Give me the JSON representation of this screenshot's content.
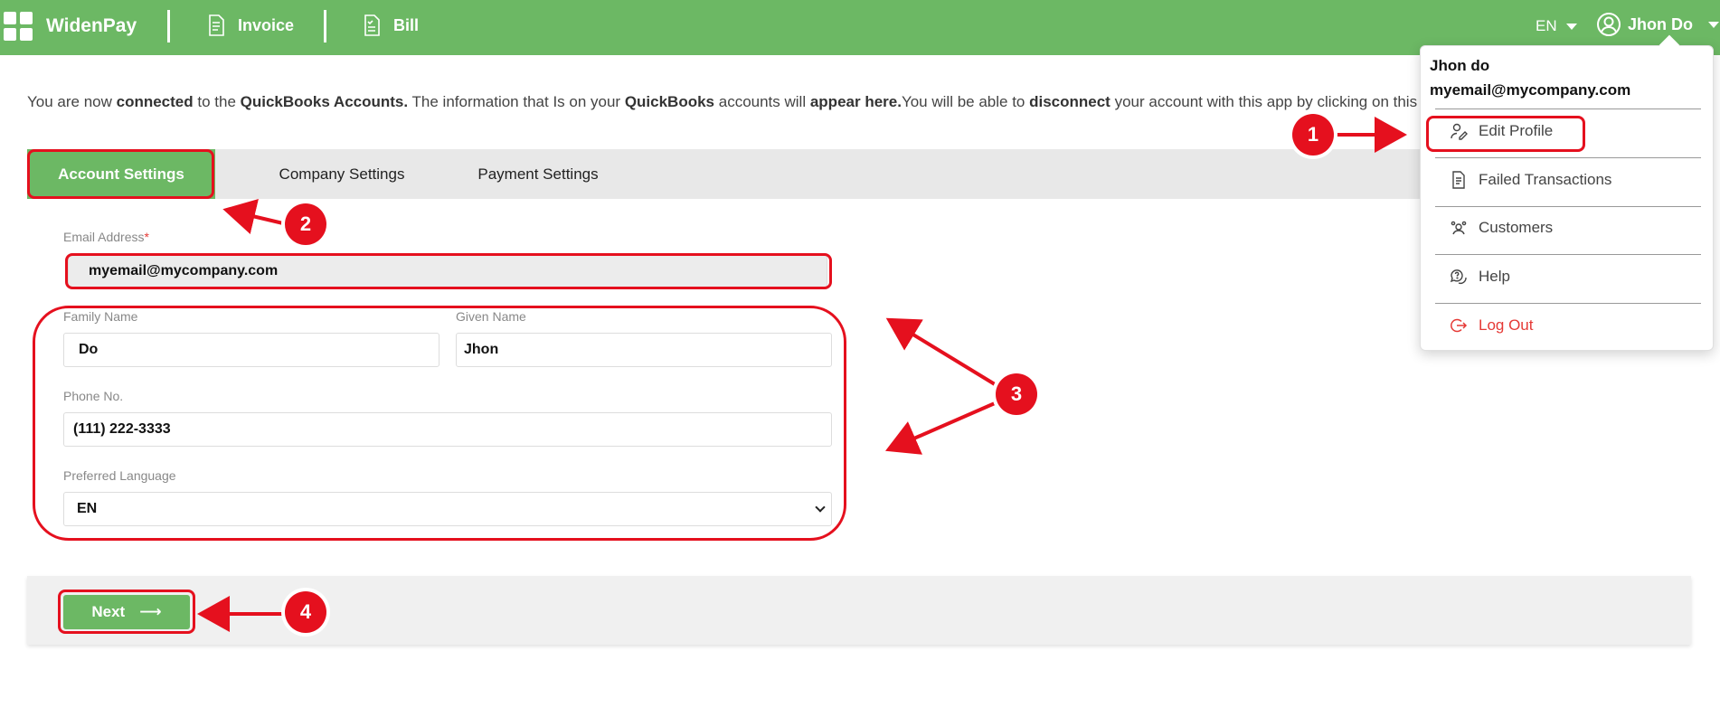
{
  "topbar": {
    "brand": "WidenPay",
    "nav": [
      {
        "label": "Invoice"
      },
      {
        "label": "Bill"
      }
    ],
    "language": "EN",
    "user": "Jhon Do"
  },
  "info": {
    "t1": "You are now ",
    "b1": "connected",
    "t2": " to the ",
    "b2": "QuickBooks Accounts.",
    "t3": " The information that Is on your ",
    "b3": "QuickBooks",
    "t4": " accounts will ",
    "b4": "appear here.",
    "t5": "You will be able to ",
    "b5": "disconnect",
    "t6": " your account with this app by clicking on this link to"
  },
  "tabs": [
    {
      "label": "Account Settings"
    },
    {
      "label": "Company Settings"
    },
    {
      "label": "Payment Settings"
    }
  ],
  "form": {
    "email_label": "Email Address",
    "email_required": "*",
    "email_value": "myemail@mycompany.com",
    "family_label": "Family Name",
    "family_value": "Do",
    "given_label": "Given Name",
    "given_value": "Jhon",
    "phone_label": "Phone No.",
    "phone_value": "(111) 222-3333",
    "language_label": "Preferred Language",
    "language_value": "EN"
  },
  "next_label": "Next",
  "next_arrow": "⟶",
  "menu": {
    "name": "Jhon do",
    "email": "myemail@mycompany.com",
    "items": [
      {
        "label": "Edit Profile"
      },
      {
        "label": "Failed Transactions"
      },
      {
        "label": "Customers"
      },
      {
        "label": "Help"
      },
      {
        "label": "Log Out"
      }
    ]
  },
  "annotations": {
    "badges": [
      "1",
      "2",
      "3",
      "4"
    ],
    "color": "#e5101e"
  },
  "colors": {
    "brand_green": "#6cb864",
    "logout_red": "#e53935"
  }
}
